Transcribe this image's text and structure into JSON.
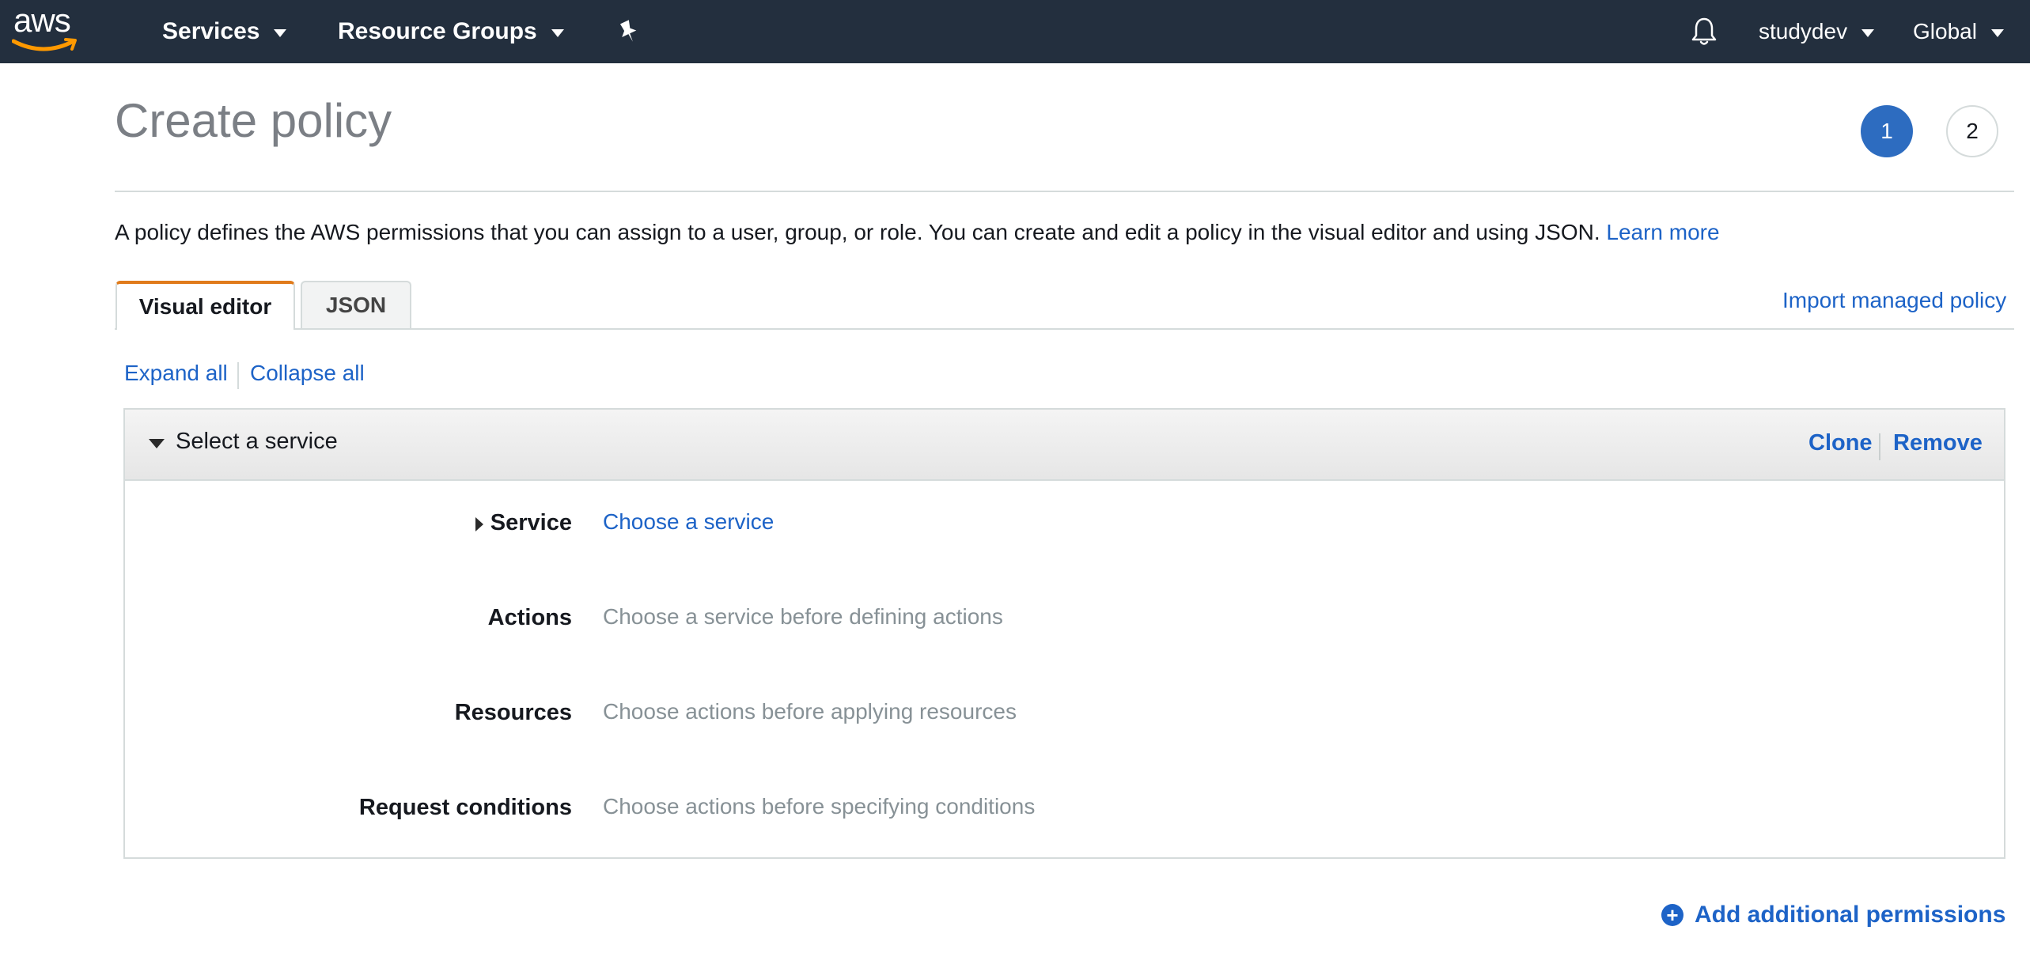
{
  "topbar": {
    "logo_text": "aws",
    "services_label": "Services",
    "resource_groups_label": "Resource Groups",
    "pin_icon": "pin-icon",
    "bell_icon": "bell-icon",
    "user_label": "studydev",
    "region_label": "Global"
  },
  "header": {
    "title": "Create policy",
    "steps": [
      "1",
      "2"
    ]
  },
  "intro": {
    "text": "A policy defines the AWS permissions that you can assign to a user, group, or role. You can create and edit a policy in the visual editor and using JSON.",
    "learn_more": "Learn more"
  },
  "tabs": [
    {
      "label": "Visual editor",
      "active": true
    },
    {
      "label": "JSON",
      "active": false
    }
  ],
  "import_label": "Import managed policy",
  "expand_all": "Expand all",
  "collapse_all": "Collapse all",
  "policy": {
    "header_label": "Select a service",
    "clone_label": "Clone",
    "remove_label": "Remove",
    "rows": [
      {
        "label": "Service",
        "value": "Choose a service"
      },
      {
        "label": "Actions",
        "value": "Choose a service before defining actions"
      },
      {
        "label": "Resources",
        "value": "Choose actions before applying resources"
      },
      {
        "label": "Request conditions",
        "value": "Choose actions before specifying conditions"
      }
    ]
  },
  "add_permissions_label": "Add additional permissions",
  "colors": {
    "topbar_bg": "#232f3e",
    "link": "#1d63c7",
    "active_tab_accent": "#e07b1b",
    "step_active": "#2d6cc0"
  }
}
